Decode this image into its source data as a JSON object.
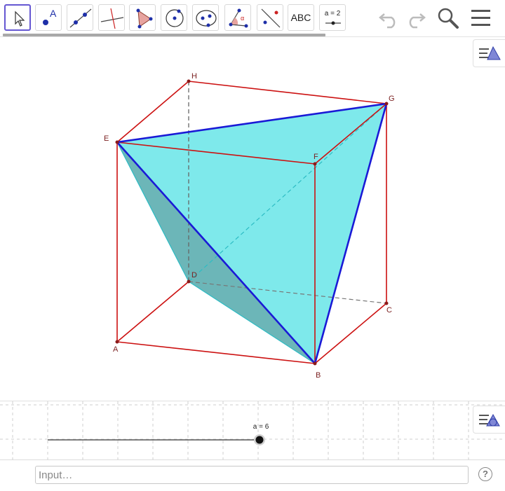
{
  "toolbar": {
    "tools": [
      {
        "name": "move-tool",
        "selected": true
      },
      {
        "name": "point-tool",
        "label": "A"
      },
      {
        "name": "line-tool"
      },
      {
        "name": "perpendicular-line-tool"
      },
      {
        "name": "polygon-tool"
      },
      {
        "name": "circle-tool"
      },
      {
        "name": "ellipse-tool"
      },
      {
        "name": "angle-tool",
        "label": "α"
      },
      {
        "name": "reflect-tool"
      },
      {
        "name": "text-tool",
        "label": "ABC"
      },
      {
        "name": "slider-tool",
        "label": "a = 2"
      }
    ],
    "undo_icon": "undo-icon",
    "redo_icon": "redo-icon",
    "search_icon": "search-icon",
    "menu_icon": "menu-icon"
  },
  "graphics3d": {
    "points": {
      "A": "A",
      "B": "B",
      "C": "C",
      "D": "D",
      "E": "E",
      "F": "F",
      "G": "G",
      "H": "H"
    },
    "colors": {
      "cube_edges": "#cc1111",
      "tetra_faces": "#5ee0e4",
      "tetra_edges": "#1a1ad6",
      "points": "#8b1a1a"
    }
  },
  "graphics2d": {
    "slider": {
      "label": "a = 6",
      "value": 6,
      "min": 0,
      "max": 6
    }
  },
  "inputbar": {
    "placeholder": "Input…",
    "help_label": "?"
  }
}
